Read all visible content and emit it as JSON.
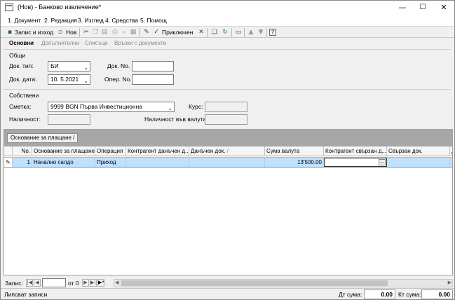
{
  "window": {
    "title": "(Нов) - Банково извлечение*",
    "minimize": "—",
    "maximize": "☐",
    "close": "✕"
  },
  "menu": [
    "1. Документ",
    "2. Редакция",
    "3. Изглед",
    "4. Средства",
    "5. Помощ"
  ],
  "toolbar": {
    "save_close": "Запис и изход",
    "new": "Нов",
    "post": "Приключен"
  },
  "tabs": [
    "Основни",
    "Допълнителни",
    "Списъци",
    "Връзки с документи"
  ],
  "general": {
    "group_label": "Общи",
    "doc_type_label": "Док. тип:",
    "doc_type_value": "БИ",
    "doc_no_label": "Док. No.",
    "doc_no_value": "",
    "doc_date_label": "Док. дата:",
    "doc_date_value": "10.  5.2021",
    "oper_no_label": "Опер. No.",
    "oper_no_value": ""
  },
  "own": {
    "group_label": "Собствени",
    "account_label": "Сметка:",
    "account_value": "9999 BGN Първа Инвестиционна",
    "rate_label": "Курс:",
    "rate_value": "",
    "availability_label": "Наличност:",
    "availability_value": "",
    "availability_currency_label": "Наличност във валута:",
    "availability_currency_value": ""
  },
  "grid": {
    "group_chip": "Основание за плащане",
    "columns": [
      "No.",
      "Основание за плащане",
      "Операция",
      "Контрагент данъчен д...",
      "Данъчен док.",
      "Сума валута",
      "Контрагент свързан д...",
      "Свързан док.",
      "Д"
    ],
    "rows": [
      {
        "no": "1",
        "basis": "Начално салдо",
        "operation": "Приход",
        "contragent_tax": "",
        "tax_doc": "",
        "amount": "13'500.00",
        "contragent_linked": "",
        "linked_doc": ""
      }
    ]
  },
  "navigator": {
    "record_label": "Запис:",
    "record_value": "",
    "of_label": "от 0"
  },
  "status": {
    "message": "Липсват записи",
    "debit_label": "Дт сума:",
    "debit_value": "0.00",
    "credit_label": "Кт сума:",
    "credit_value": "0.00"
  }
}
